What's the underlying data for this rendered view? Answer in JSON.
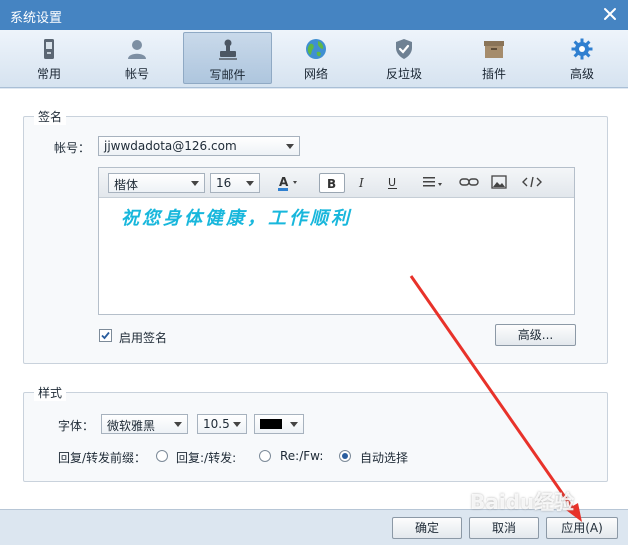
{
  "window": {
    "title": "系统设置"
  },
  "toolbar": {
    "tabs": [
      {
        "label": "常用",
        "icon": "phone-icon"
      },
      {
        "label": "帐号",
        "icon": "user-icon"
      },
      {
        "label": "写邮件",
        "icon": "stamp-icon",
        "active": true
      },
      {
        "label": "网络",
        "icon": "globe-icon"
      },
      {
        "label": "反垃圾",
        "icon": "shield-icon"
      },
      {
        "label": "插件",
        "icon": "box-icon"
      },
      {
        "label": "高级",
        "icon": "gear-icon"
      }
    ]
  },
  "signature": {
    "section_title": "签名",
    "account_label": "帐号：",
    "account_value": "jjwwdadota@126.com",
    "font_family": "楷体",
    "font_size": "16",
    "text": "祝您身体健康，工作顺利",
    "enable_label": "启用签名",
    "enable_checked": true,
    "advanced_button": "高级..."
  },
  "style": {
    "section_title": "样式",
    "font_label": "字体：",
    "font_value": "微软雅黑",
    "size_value": "10.5",
    "color_value": "#000000",
    "prefix_label": "回复/转发前缀：",
    "options": [
      "回复:/转发:",
      "Re:/Fw:",
      "自动选择"
    ],
    "selected_option": 2
  },
  "footer": {
    "ok": "确定",
    "cancel": "取消",
    "apply": "应用(A)"
  },
  "watermark": "Baidu经验",
  "colors": {
    "title_bar": "#4584c2",
    "signature_text": "#18b7dc",
    "annotation_arrow": "#e8322a"
  }
}
